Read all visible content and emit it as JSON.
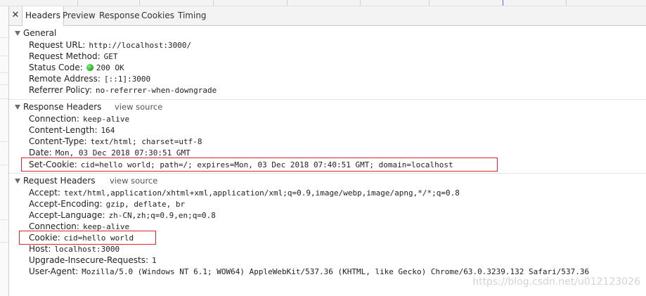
{
  "tabs": {
    "close_glyph": "✕",
    "items": [
      "Headers",
      "Preview",
      "Response",
      "Cookies",
      "Timing"
    ],
    "active": "Headers"
  },
  "general": {
    "title": "General",
    "rows": [
      {
        "key": "Request URL:",
        "value": "http://localhost:3000/"
      },
      {
        "key": "Request Method:",
        "value": "GET"
      },
      {
        "key": "Status Code:",
        "value": "200 OK"
      },
      {
        "key": "Remote Address:",
        "value": "[::1]:3000"
      },
      {
        "key": "Referrer Policy:",
        "value": "no-referrer-when-downgrade"
      }
    ],
    "status_color": "#1aa51a"
  },
  "response_headers": {
    "title": "Response Headers",
    "view_source": "view source",
    "rows": [
      {
        "key": "Connection:",
        "value": "keep-alive"
      },
      {
        "key": "Content-Length:",
        "value": "164"
      },
      {
        "key": "Content-Type:",
        "value": "text/html; charset=utf-8"
      },
      {
        "key": "Date:",
        "value": "Mon, 03 Dec 2018 07:30:51 GMT"
      },
      {
        "key": "Set-Cookie:",
        "value": "cid=hello world; path=/; expires=Mon, 03 Dec 2018 07:40:51 GMT; domain=localhost"
      }
    ]
  },
  "request_headers": {
    "title": "Request Headers",
    "view_source": "view source",
    "rows": [
      {
        "key": "Accept:",
        "value": "text/html,application/xhtml+xml,application/xml;q=0.9,image/webp,image/apng,*/*;q=0.8"
      },
      {
        "key": "Accept-Encoding:",
        "value": "gzip, deflate, br"
      },
      {
        "key": "Accept-Language:",
        "value": "zh-CN,zh;q=0.9,en;q=0.8"
      },
      {
        "key": "Connection:",
        "value": "keep-alive"
      },
      {
        "key": "Cookie:",
        "value": "cid=hello world"
      },
      {
        "key": "Host:",
        "value": "localhost:3000"
      },
      {
        "key": "Upgrade-Insecure-Requests:",
        "value": "1"
      },
      {
        "key": "User-Agent:",
        "value": "Mozilla/5.0 (Windows NT 6.1; WOW64) AppleWebKit/537.36 (KHTML, like Gecko) Chrome/63.0.3239.132 Safari/537.36"
      }
    ]
  },
  "highlight_color": "#e0222a",
  "watermark": "https://blog.csdn.net/u012123026"
}
